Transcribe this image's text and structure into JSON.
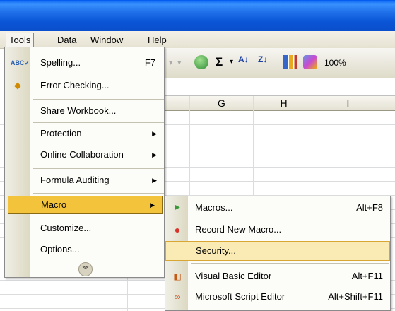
{
  "menubar": {
    "items": [
      {
        "label": "Tools"
      },
      {
        "label": "Data"
      },
      {
        "label": "Window"
      },
      {
        "label": "Help"
      }
    ]
  },
  "toolbar": {
    "zoom": "100%",
    "sigma": "Σ"
  },
  "columns": [
    "G",
    "H",
    "I"
  ],
  "tools_menu": {
    "items": [
      {
        "label": "Spelling...",
        "shortcut": "F7",
        "icon": "spelling-abc-icon"
      },
      {
        "label": "Error Checking...",
        "icon": "error-checking-icon"
      },
      {
        "label": "Share Workbook..."
      },
      {
        "label": "Protection"
      },
      {
        "label": "Online Collaboration"
      },
      {
        "label": "Formula Auditing"
      },
      {
        "label": "Macro"
      },
      {
        "label": "Customize..."
      },
      {
        "label": "Options..."
      }
    ]
  },
  "macro_submenu": {
    "items": [
      {
        "label": "Macros...",
        "shortcut": "Alt+F8",
        "icon": "play-macro-icon"
      },
      {
        "label": "Record New Macro...",
        "icon": "record-icon"
      },
      {
        "label": "Security..."
      },
      {
        "label": "Visual Basic Editor",
        "shortcut": "Alt+F11",
        "icon": "vb-editor-icon"
      },
      {
        "label": "Microsoft Script Editor",
        "shortcut": "Alt+Shift+F11",
        "icon": "script-editor-icon"
      }
    ]
  },
  "colors": {
    "highlight": "#f2c33b",
    "submenu_highlight": "#faebb4",
    "titlebar": "#0a55d6"
  }
}
